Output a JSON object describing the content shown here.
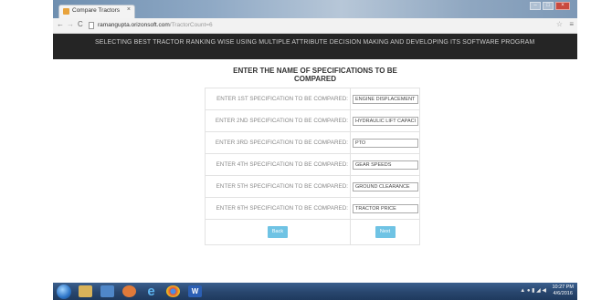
{
  "browser": {
    "tab_title": "Compare Tractors",
    "tab_close": "×",
    "window_buttons": [
      "–",
      "□",
      "×"
    ],
    "url_host": "ramangupta.orizonsoft.com",
    "url_rest": "/TractorCount=6"
  },
  "site": {
    "header_title": "SELECTING BEST TRACTOR RANKING WISE USING MULTIPLE ATTRIBUTE DECISION MAKING AND DEVELOPING ITS SOFTWARE PROGRAM"
  },
  "form": {
    "heading_line1": "ENTER THE NAME OF SPECIFICATIONS TO BE",
    "heading_line2": "COMPARED",
    "rows": [
      {
        "label": "ENTER 1ST SPECIFICATION TO BE COMPARED:",
        "value": "ENGINE DISPLACEMENT"
      },
      {
        "label": "ENTER 2ND SPECIFICATION TO BE COMPARED:",
        "value": "HYDRAULIC LIFT CAPACI"
      },
      {
        "label": "ENTER 3RD SPECIFICATION TO BE COMPARED:",
        "value": "PTO"
      },
      {
        "label": "ENTER 4TH SPECIFICATION TO BE COMPARED:",
        "value": "GEAR SPEEDS"
      },
      {
        "label": "ENTER 5TH SPECIFICATION TO BE COMPARED:",
        "value": "GROUND CLEARANCE"
      },
      {
        "label": "ENTER 6TH SPECIFICATION TO BE COMPARED:",
        "value": "TRACTOR PRICE"
      }
    ],
    "back_label": "Back",
    "next_label": "Next"
  },
  "taskbar": {
    "tray_text": "▲ ● ▮ ◢ ◀",
    "clock_time": "10:27 PM",
    "clock_date": "4/6/2016"
  },
  "colors": {
    "header_bg": "#252525",
    "button_bg": "#6fc3e4"
  }
}
